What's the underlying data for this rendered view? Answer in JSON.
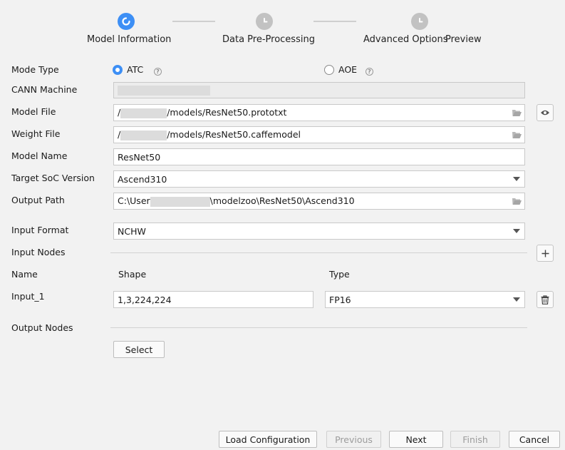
{
  "stepper": {
    "steps": [
      {
        "label": "Model Information",
        "state": "active"
      },
      {
        "label": "Data Pre-Processing",
        "state": "pending"
      },
      {
        "label": "Advanced Options",
        "state": "pending"
      },
      {
        "label": "Preview",
        "state": "pending"
      }
    ]
  },
  "form": {
    "mode_type": {
      "label": "Mode Type",
      "options": [
        "ATC",
        "AOE"
      ],
      "selected": "ATC",
      "help": "?"
    },
    "cann_machine": {
      "label": "CANN Machine",
      "value": ""
    },
    "model_file": {
      "label": "Model File",
      "prefix": "/",
      "value": "/models/ResNet50.prototxt"
    },
    "weight_file": {
      "label": "Weight File",
      "prefix": "/",
      "value": "/models/ResNet50.caffemodel"
    },
    "model_name": {
      "label": "Model Name",
      "value": "ResNet50"
    },
    "target_soc": {
      "label": "Target SoC Version",
      "value": "Ascend310"
    },
    "output_path": {
      "label": "Output Path",
      "prefix": "C:\\User",
      "value": "\\modelzoo\\ResNet50\\Ascend310"
    },
    "input_format": {
      "label": "Input Format",
      "value": "NCHW"
    },
    "input_nodes": {
      "label": "Input Nodes",
      "columns": {
        "name": "Name",
        "shape": "Shape",
        "type": "Type"
      },
      "rows": [
        {
          "name": "Input_1",
          "shape": "1,3,224,224",
          "type": "FP16"
        }
      ]
    },
    "output_nodes": {
      "label": "Output Nodes",
      "select_label": "Select"
    }
  },
  "footer": {
    "load": "Load Configuration",
    "previous": "Previous",
    "next": "Next",
    "finish": "Finish",
    "cancel": "Cancel"
  },
  "colors": {
    "accent": "#3d8ff5",
    "pending": "#c2c2c2"
  }
}
